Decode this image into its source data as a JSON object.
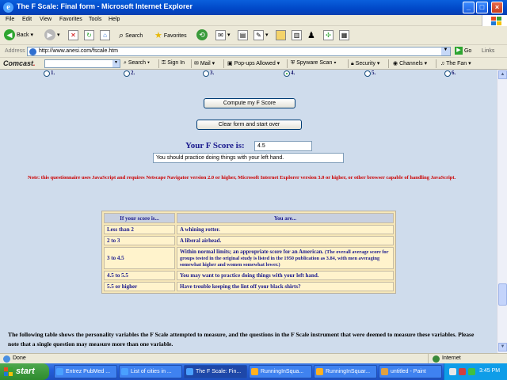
{
  "window": {
    "title": "The F Scale: Final form - Microsoft Internet Explorer"
  },
  "menu": [
    "File",
    "Edit",
    "View",
    "Favorites",
    "Tools",
    "Help"
  ],
  "toolbar": {
    "back": "Back",
    "search": "Search",
    "favorites": "Favorites"
  },
  "address": {
    "label": "Address",
    "url": "http://www.anesi.com/fscale.htm",
    "go": "Go",
    "links": "Links"
  },
  "comcast_bar": {
    "logo": "Comcast",
    "logo_dot": ".",
    "search": "Search",
    "sign_in": "Sign In",
    "mail": "Mail",
    "popups": "Pop-ups Allowed",
    "spyware": "Spyware Scan",
    "security": "Security",
    "channels": "Channels",
    "fan": "The Fan"
  },
  "radio_options": [
    {
      "label": "1.",
      "checked": false
    },
    {
      "label": "2.",
      "checked": false
    },
    {
      "label": "3.",
      "checked": false
    },
    {
      "label": "4.",
      "checked": true
    },
    {
      "label": "5.",
      "checked": false
    },
    {
      "label": "6.",
      "checked": false
    }
  ],
  "form": {
    "compute_button": "Compute my F Score",
    "clear_button": "Clear form and start over",
    "score_label": "Your F Score is:",
    "score_value": "4.5",
    "message_value": "You should practice doing things with your left hand."
  },
  "note": "Note: this questionnaire uses JavaScript and requires Netscape Navigator version 2.0 or higher, Microsoft Internet Explorer version 3.0 or higher, or other browser capable of handling JavaScript.",
  "score_table": {
    "headers": [
      "If your score is...",
      "You are..."
    ],
    "rows": [
      {
        "range": "Less than 2",
        "desc": "A whining rotter."
      },
      {
        "range": "2 to 3",
        "desc": "A liberal airhead."
      },
      {
        "range": "3 to 4.5",
        "desc": "Within normal limits; an appropriate score for an American.",
        "detail": "(The overall average score for groups tested in the original study is listed in the 1950 publication as 3.84, with men averaging somewhat higher and women somewhat lower.)"
      },
      {
        "range": "4.5 to 5.5",
        "desc": "You may want to practice doing things with your left hand."
      },
      {
        "range": "5.5 or higher",
        "desc": "Have trouble keeping the lint off your black shirts?"
      }
    ]
  },
  "bottom_text": "The following table shows the personality variables the F Scale attempted to measure, and the questions in the F Scale instrument that were deemed to measure these variables. Please note that a single question may measure more than one variable.",
  "status": {
    "left": "Done",
    "zone": "Internet"
  },
  "taskbar": {
    "start": "start",
    "tasks": [
      {
        "label": "Entrez PubMed ...",
        "active": false
      },
      {
        "label": "List of cities in ...",
        "active": false
      },
      {
        "label": "The F Scale: Fin...",
        "active": true
      },
      {
        "label": "RunningInSqua...",
        "active": false
      },
      {
        "label": "RunningInSquar...",
        "active": false
      },
      {
        "label": "untitled - Paint",
        "active": false
      }
    ],
    "clock": "3:45 PM"
  }
}
